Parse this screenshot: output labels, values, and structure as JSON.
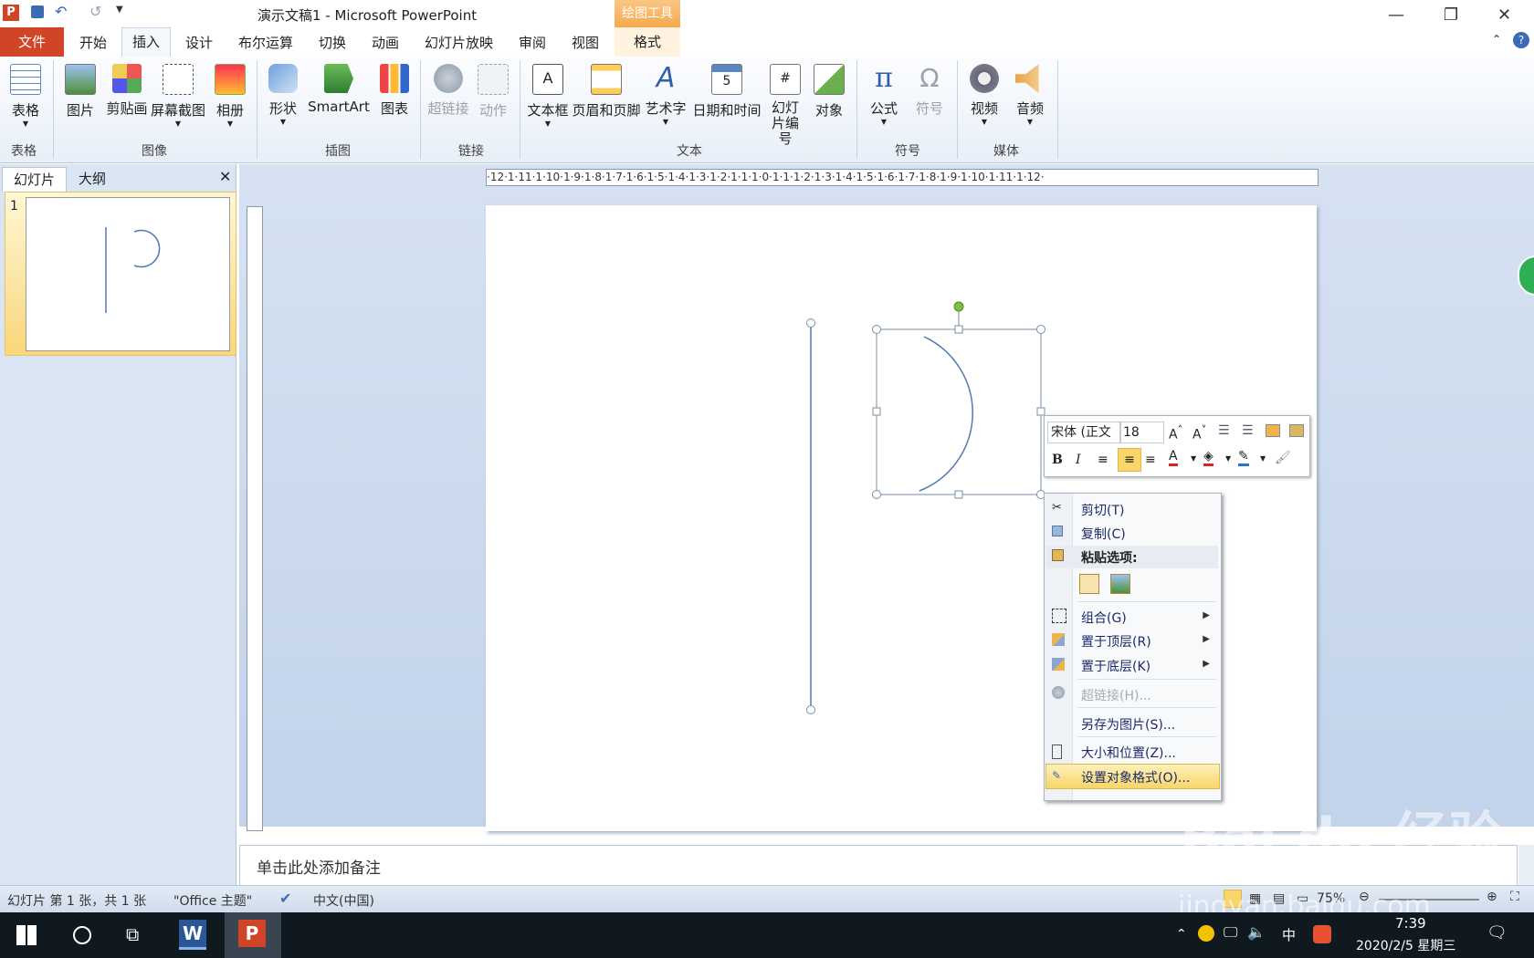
{
  "window": {
    "title": "演示文稿1 - Microsoft PowerPoint",
    "context_tool": "绘图工具"
  },
  "tabs": [
    "文件",
    "开始",
    "插入",
    "设计",
    "布尔运算",
    "切换",
    "动画",
    "幻灯片放映",
    "审阅",
    "视图",
    "格式"
  ],
  "active_tab": "插入",
  "ribbon": {
    "buttons": [
      {
        "label": "表格",
        "icon": "table-icon",
        "enabled": true
      },
      {
        "label": "图片",
        "icon": "picture-icon",
        "enabled": true
      },
      {
        "label": "剪贴画",
        "icon": "clipart-icon",
        "enabled": true
      },
      {
        "label": "屏幕截图",
        "icon": "screenshot-icon",
        "enabled": true
      },
      {
        "label": "相册",
        "icon": "album-icon",
        "enabled": true
      },
      {
        "label": "形状",
        "icon": "shapes-icon",
        "enabled": true
      },
      {
        "label": "SmartArt",
        "icon": "smartart-icon",
        "enabled": true
      },
      {
        "label": "图表",
        "icon": "chart-icon",
        "enabled": true
      },
      {
        "label": "超链接",
        "icon": "hyperlink-icon",
        "enabled": false
      },
      {
        "label": "动作",
        "icon": "action-icon",
        "enabled": false
      },
      {
        "label": "文本框",
        "icon": "textbox-icon",
        "enabled": true
      },
      {
        "label": "页眉和页脚",
        "icon": "header-footer-icon",
        "enabled": true
      },
      {
        "label": "艺术字",
        "icon": "wordart-icon",
        "enabled": true
      },
      {
        "label": "日期和时间",
        "icon": "datetime-icon",
        "enabled": true
      },
      {
        "label": "幻灯片编号",
        "icon": "slide-number-icon",
        "enabled": true
      },
      {
        "label": "对象",
        "icon": "object-icon",
        "enabled": true
      },
      {
        "label": "公式",
        "icon": "equation-icon",
        "enabled": true
      },
      {
        "label": "符号",
        "icon": "symbol-icon",
        "enabled": false
      },
      {
        "label": "视频",
        "icon": "video-icon",
        "enabled": true
      },
      {
        "label": "音频",
        "icon": "audio-icon",
        "enabled": true
      }
    ],
    "groups": [
      "表格",
      "图像",
      "插图",
      "链接",
      "文本",
      "符号",
      "媒体"
    ]
  },
  "panel": {
    "tab_slides": "幻灯片",
    "tab_outline": "大纲",
    "slide_number": "1"
  },
  "ruler": {
    "h": "·12·1·11·1·10·1·9·1·8·1·7·1·6·1·5·1·4·1·3·1·2·1·1·1·0·1·1·1·2·1·3·1·4·1·5·1·6·1·7·1·8·1·9·1·10·1·11·1·12·"
  },
  "mini_toolbar": {
    "font": "宋体 (正文",
    "size": "18",
    "bold": "B",
    "italic": "I"
  },
  "context_menu": {
    "cut": "剪切(T)",
    "copy": "复制(C)",
    "paste_options": "粘贴选项:",
    "group": "组合(G)",
    "bring_front": "置于顶层(R)",
    "send_back": "置于底层(K)",
    "hyperlink": "超链接(H)...",
    "save_as_picture": "另存为图片(S)...",
    "size_position": "大小和位置(Z)...",
    "format_object": "设置对象格式(O)..."
  },
  "notes_placeholder": "单击此处添加备注",
  "status": {
    "slide_info": "幻灯片 第 1 张，共 1 张",
    "theme": "\"Office 主题\"",
    "language": "中文(中国)",
    "zoom": "75%"
  },
  "taskbar": {
    "time": "7:39",
    "date": "2020/2/5 星期三",
    "ime": "中"
  },
  "watermark": {
    "main": "Bai du 经验",
    "url": "jingyan.baidu.com"
  },
  "colors": {
    "file_tab": "#d04525",
    "context_tab": "#f6a94c",
    "shape_stroke": "#4f7ab5",
    "rotation_handle": "#7ac142"
  }
}
